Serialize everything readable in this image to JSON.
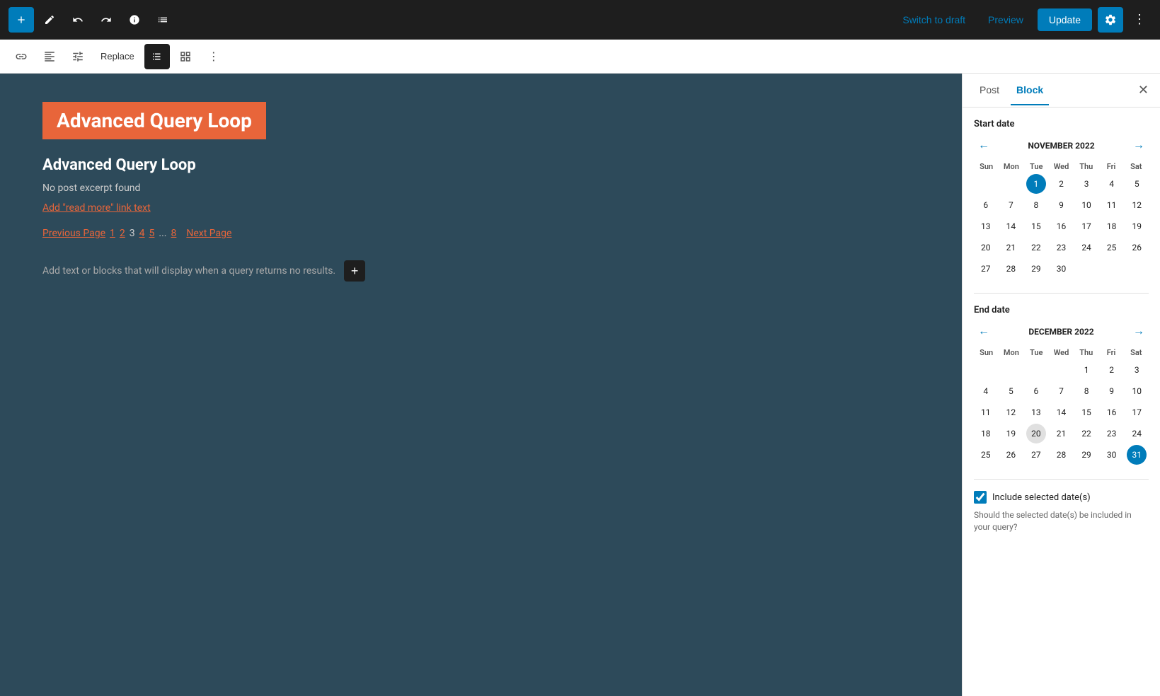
{
  "topToolbar": {
    "addLabel": "+",
    "switchToDraftLabel": "Switch to draft",
    "previewLabel": "Preview",
    "updateLabel": "Update"
  },
  "secondaryToolbar": {
    "replaceLabel": "Replace"
  },
  "editor": {
    "blockTitle": "Advanced Query Loop",
    "postTitle": "Advanced Query Loop",
    "postExcerpt": "No post excerpt found",
    "readMoreLink": "Add \"read more\" link text",
    "paginationPrevious": "Previous Page",
    "paginationNext": "Next Page",
    "paginationPages": "12345...8",
    "noResultsText": "Add text or blocks that will display when a query returns no results."
  },
  "sidebar": {
    "postTab": "Post",
    "blockTab": "Block",
    "startDateLabel": "Start date",
    "endDateLabel": "End date",
    "novemberCalendar": {
      "monthLabel": "NOVEMBER 2022",
      "dayHeaders": [
        "Sun",
        "Mon",
        "Tue",
        "Wed",
        "Thu",
        "Fri",
        "Sat"
      ],
      "weeks": [
        [
          "",
          "",
          "1",
          "2",
          "3",
          "4",
          "5"
        ],
        [
          "6",
          "7",
          "8",
          "9",
          "10",
          "11",
          "12"
        ],
        [
          "13",
          "14",
          "15",
          "16",
          "17",
          "18",
          "19"
        ],
        [
          "20",
          "21",
          "22",
          "23",
          "24",
          "25",
          "26"
        ],
        [
          "27",
          "28",
          "29",
          "30",
          "",
          "",
          ""
        ]
      ],
      "selectedDay": "1"
    },
    "decemberCalendar": {
      "monthLabel": "DECEMBER 2022",
      "dayHeaders": [
        "Sun",
        "Mon",
        "Tue",
        "Wed",
        "Thu",
        "Fri",
        "Sat"
      ],
      "weeks": [
        [
          "",
          "",
          "",
          "",
          "1",
          "2",
          "3"
        ],
        [
          "4",
          "5",
          "6",
          "7",
          "8",
          "9",
          "10"
        ],
        [
          "11",
          "12",
          "13",
          "14",
          "15",
          "16",
          "17"
        ],
        [
          "18",
          "19",
          "20",
          "21",
          "22",
          "23",
          "24"
        ],
        [
          "25",
          "26",
          "27",
          "28",
          "29",
          "30",
          "31"
        ]
      ],
      "selectedDay": "31",
      "todayDay": "20"
    },
    "includeLabel": "Include selected date(s)",
    "includeHelp": "Should the selected date(s) be included in your query?"
  }
}
